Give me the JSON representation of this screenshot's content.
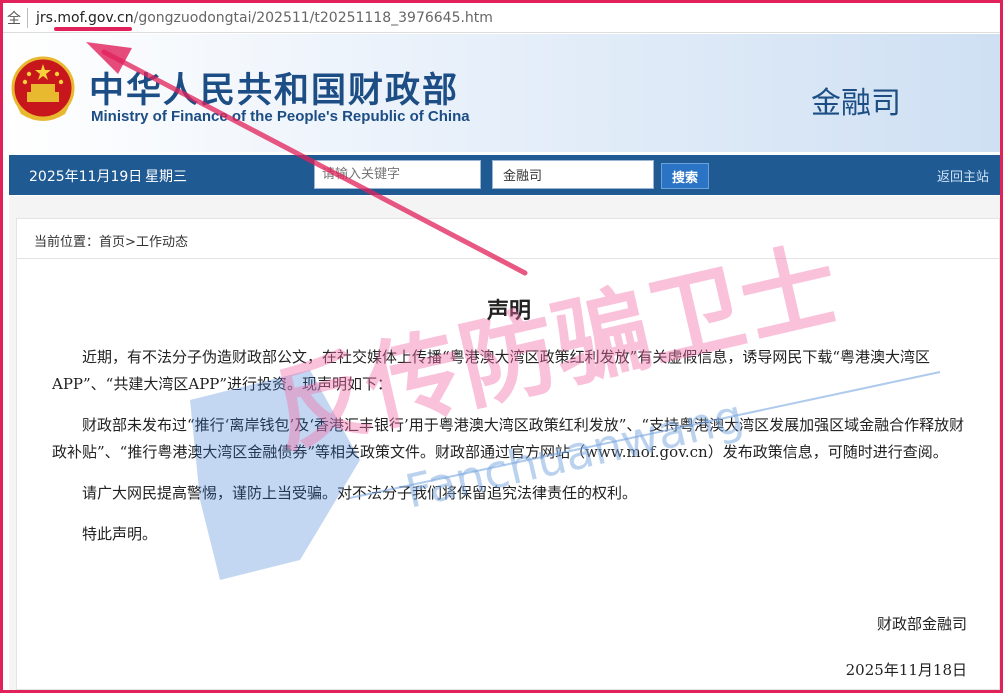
{
  "browser": {
    "url_prefix": "全",
    "url_host": "jrs.mof.gov.cn",
    "url_path": "/gongzuodongtai/202511/t20251118_3976645.htm"
  },
  "header": {
    "title_cn": "中华人民共和国财政部",
    "title_en": "Ministry of Finance of the People's Republic of China",
    "department": "金融司"
  },
  "nav": {
    "date": "2025年11月19日",
    "weekday": "星期三",
    "search_placeholder": "请输入关键字",
    "scope_value": "金融司",
    "search_button": "搜索",
    "home_link": "返回主站"
  },
  "breadcrumb": {
    "label": "当前位置：",
    "home": "首页",
    "separator": ">",
    "section": "工作动态"
  },
  "article": {
    "title": "声明",
    "paragraphs": [
      "近期，有不法分子伪造财政部公文，在社交媒体上传播“粤港澳大湾区政策红利发放”有关虚假信息，诱导网民下载“粤港澳大湾区APP”、“共建大湾区APP”进行投资。现声明如下：",
      "财政部未发布过“推行‘离岸钱包’及‘香港汇丰银行’用于粤港澳大湾区政策红利发放”、“支持粤港澳大湾区发展加强区域金融合作释放财政补贴”、“推行粤港澳大湾区金融债券”等相关政策文件。财政部通过官方网站（www.mof.gov.cn）发布政策信息，可随时进行查阅。",
      "请广大网民提高警惕，谨防上当受骗。对不法分子我们将保留追究法律责任的权利。",
      "特此声明。"
    ],
    "signature": "财政部金融司",
    "date": "2025年11月18日"
  },
  "watermark": {
    "text_cn": "反传防骗卫士",
    "text_en": "Fanchuanwang"
  },
  "colors": {
    "brand_blue": "#1c4d84",
    "nav_blue": "#1f5a93",
    "highlight_red": "#e1215a"
  }
}
